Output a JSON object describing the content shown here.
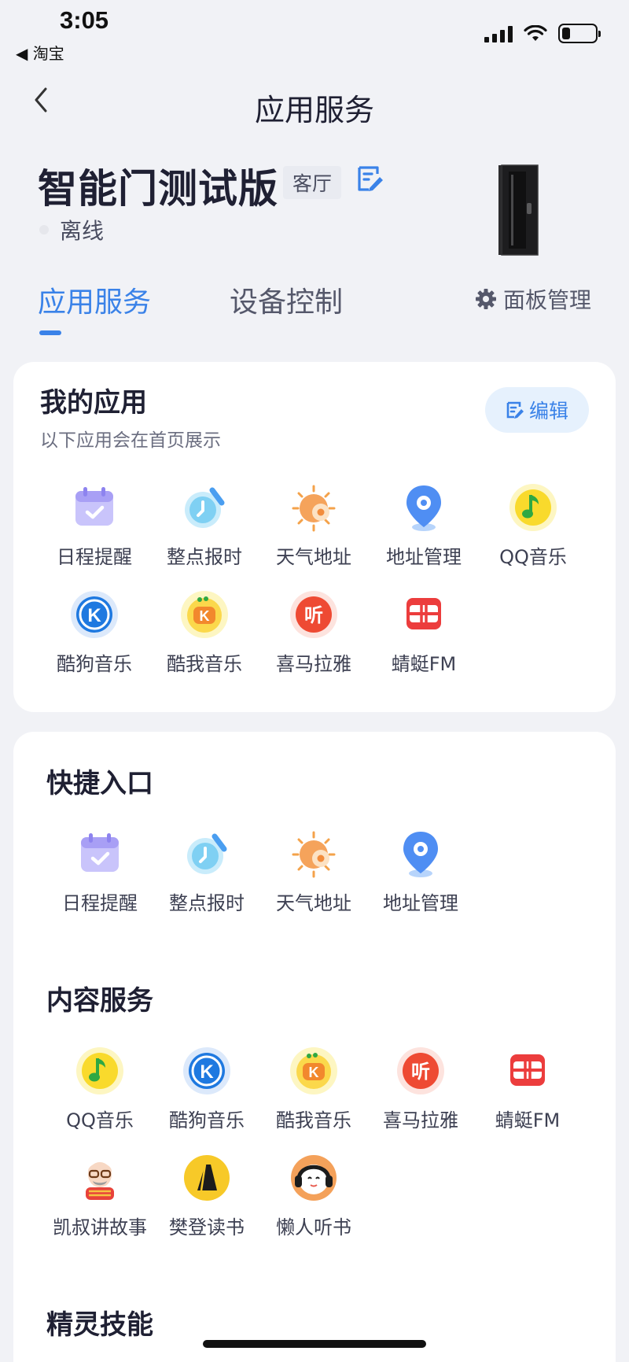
{
  "status_bar": {
    "time": "3:05",
    "back_app": "◀ 淘宝",
    "battery_level": 0.25
  },
  "nav": {
    "title": "应用服务"
  },
  "device": {
    "name": "智能门测试版",
    "room": "客厅",
    "status": "离线"
  },
  "tabs": [
    {
      "label": "应用服务",
      "active": true
    },
    {
      "label": "设备控制",
      "active": false
    }
  ],
  "panel_manage": {
    "label": "面板管理",
    "icon": "gear-icon"
  },
  "my_apps": {
    "title": "我的应用",
    "subtitle": "以下应用会在首页展示",
    "edit_label": "编辑",
    "apps": [
      {
        "label": "日程提醒",
        "icon": "calendar-icon"
      },
      {
        "label": "整点报时",
        "icon": "clock-icon"
      },
      {
        "label": "天气地址",
        "icon": "weather-icon"
      },
      {
        "label": "地址管理",
        "icon": "location-pin-icon"
      },
      {
        "label": "QQ音乐",
        "icon": "qq-music-icon"
      },
      {
        "label": "酷狗音乐",
        "icon": "kugou-icon"
      },
      {
        "label": "酷我音乐",
        "icon": "kuwo-icon"
      },
      {
        "label": "喜马拉雅",
        "icon": "ximalaya-icon"
      },
      {
        "label": "蜻蜓FM",
        "icon": "qingting-fm-icon"
      }
    ]
  },
  "shortcuts": {
    "title": "快捷入口",
    "apps": [
      {
        "label": "日程提醒",
        "icon": "calendar-icon"
      },
      {
        "label": "整点报时",
        "icon": "clock-icon"
      },
      {
        "label": "天气地址",
        "icon": "weather-icon"
      },
      {
        "label": "地址管理",
        "icon": "location-pin-icon"
      }
    ]
  },
  "content_services": {
    "title": "内容服务",
    "apps": [
      {
        "label": "QQ音乐",
        "icon": "qq-music-icon"
      },
      {
        "label": "酷狗音乐",
        "icon": "kugou-icon"
      },
      {
        "label": "酷我音乐",
        "icon": "kuwo-icon"
      },
      {
        "label": "喜马拉雅",
        "icon": "ximalaya-icon"
      },
      {
        "label": "蜻蜓FM",
        "icon": "qingting-fm-icon"
      },
      {
        "label": "凯叔讲故事",
        "icon": "kaishu-icon"
      },
      {
        "label": "樊登读书",
        "icon": "fandeng-icon"
      },
      {
        "label": "懒人听书",
        "icon": "lanren-icon"
      }
    ]
  },
  "skills": {
    "title": "精灵技能"
  },
  "colors": {
    "accent": "#3a82e8",
    "background": "#f1f2f6",
    "card": "#ffffff"
  }
}
